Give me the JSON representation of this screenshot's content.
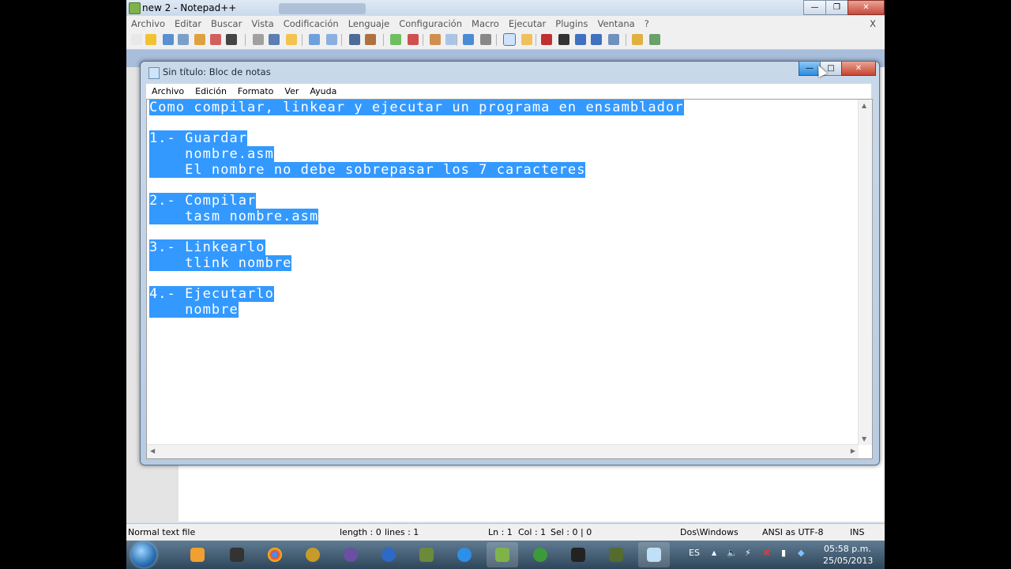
{
  "npp": {
    "title": "new  2 - Notepad++",
    "menu": [
      "Archivo",
      "Editar",
      "Buscar",
      "Vista",
      "Codificación",
      "Lenguaje",
      "Configuración",
      "Macro",
      "Ejecutar",
      "Plugins",
      "Ventana",
      "?"
    ],
    "menu_close": "X",
    "status": {
      "type": "Normal text file",
      "length": "length : 0",
      "lines": "lines : 1",
      "ln": "Ln : 1",
      "col": "Col : 1",
      "sel": "Sel : 0 | 0",
      "eol": "Dos\\Windows",
      "encoding": "ANSI as UTF-8",
      "mode": "INS"
    }
  },
  "notepad": {
    "title": "Sin título: Bloc de notas",
    "menu": [
      "Archivo",
      "Edición",
      "Formato",
      "Ver",
      "Ayuda"
    ],
    "lines": [
      "Como compilar, linkear y ejecutar un programa en ensamblador",
      "",
      "1.- Guardar",
      "    nombre.asm",
      "    El nombre no debe sobrepasar los 7 caracteres",
      "",
      "2.- Compilar",
      "    tasm nombre.asm",
      "",
      "3.- Linkearlo",
      "    tlink nombre",
      "",
      "4.- Ejecutarlo",
      "    nombre"
    ]
  },
  "taskbar": {
    "lang": "ES",
    "time": "05:58 p.m.",
    "date": "25/05/2013"
  },
  "colors": {
    "selection": "#3399ff",
    "taskbar": "#3f5a70"
  }
}
